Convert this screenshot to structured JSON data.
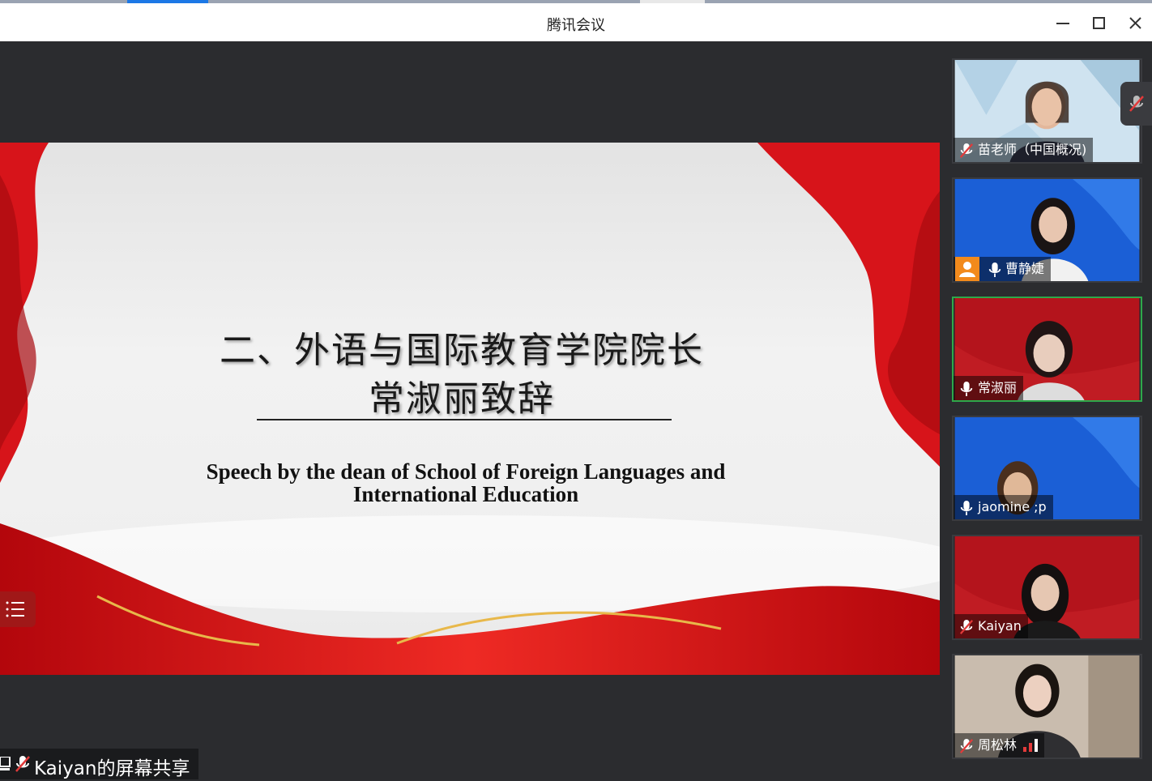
{
  "window": {
    "title": "腾讯会议"
  },
  "slide": {
    "title_line1": "二、外语与国际教育学院院长",
    "title_line2": "常淑丽致辞",
    "subtitle_line1": "Speech by the dean of School of Foreign Languages and",
    "subtitle_line2": "International Education"
  },
  "share": {
    "label": "Kaiyan的屏幕共享"
  },
  "participants": [
    {
      "name": "苗老师（中国概况)",
      "muted": true,
      "bg": "light"
    },
    {
      "name": "曹静婕",
      "muted": false,
      "bg": "blue"
    },
    {
      "name": "常淑丽",
      "muted": false,
      "bg": "red",
      "active": true
    },
    {
      "name": "jaomine ;p",
      "muted": false,
      "bg": "blue"
    },
    {
      "name": "Kaiyan",
      "muted": true,
      "bg": "red"
    },
    {
      "name": "周松林",
      "muted": true,
      "bg": "room"
    }
  ],
  "colors": {
    "accent_red": "#c8101a",
    "active_border": "#2ea84a",
    "blue_bg": "#1b5fd6"
  }
}
